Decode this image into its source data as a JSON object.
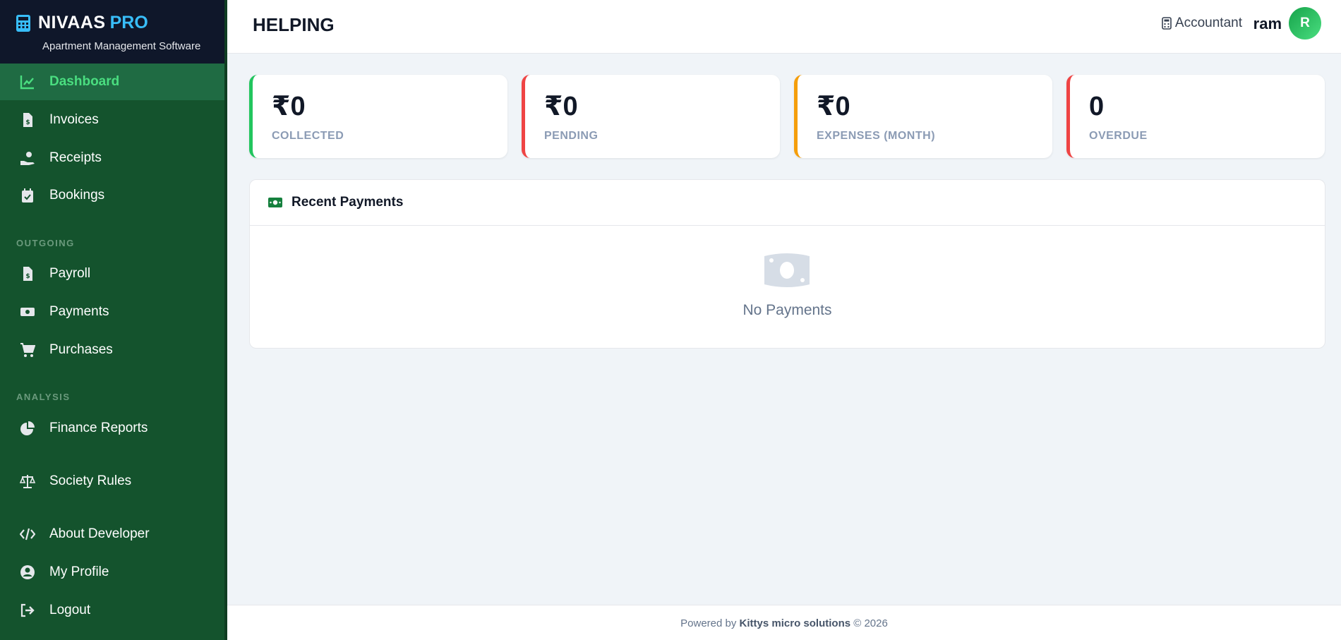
{
  "brand": {
    "name": "NIVAAS",
    "suffix": "PRO",
    "subtitle": "Apartment Management Software"
  },
  "sidebar": {
    "items": [
      {
        "label": "Dashboard",
        "icon": "chart-line-icon",
        "active": true
      },
      {
        "label": "Invoices",
        "icon": "invoice-icon"
      },
      {
        "label": "Receipts",
        "icon": "hand-money-icon"
      },
      {
        "label": "Bookings",
        "icon": "calendar-check-icon"
      },
      {
        "label": "Payroll",
        "icon": "invoice-dollar-icon"
      },
      {
        "label": "Payments",
        "icon": "money-bill-icon"
      },
      {
        "label": "Purchases",
        "icon": "cart-icon"
      },
      {
        "label": "Finance Reports",
        "icon": "pie-chart-icon"
      },
      {
        "label": "Society Rules",
        "icon": "scale-icon"
      },
      {
        "label": "About Developer",
        "icon": "code-icon"
      },
      {
        "label": "My Profile",
        "icon": "user-circle-icon"
      },
      {
        "label": "Logout",
        "icon": "logout-icon"
      }
    ],
    "sections": {
      "outgoing": "OUTGOING",
      "analysis": "ANALYSIS"
    }
  },
  "header": {
    "title": "HELPING",
    "role": "Accountant",
    "username": "ram",
    "avatar_initial": "R"
  },
  "stats": [
    {
      "value": "₹0",
      "label": "COLLECTED",
      "color": "#22c55e"
    },
    {
      "value": "₹0",
      "label": "PENDING",
      "color": "#ef4444"
    },
    {
      "value": "₹0",
      "label": "EXPENSES (MONTH)",
      "color": "#f59e0b"
    },
    {
      "value": "0",
      "label": "OVERDUE",
      "color": "#ef4444"
    }
  ],
  "recent_payments": {
    "title": "Recent Payments",
    "empty_text": "No Payments"
  },
  "footer": {
    "prefix": "Powered by",
    "company": "Kittys micro solutions",
    "suffix": "© 2026"
  },
  "colors": {
    "sidebar_bg": "#14532d",
    "brand_bg": "#0f172a",
    "accent": "#4ade80",
    "pro": "#38bdf8"
  }
}
